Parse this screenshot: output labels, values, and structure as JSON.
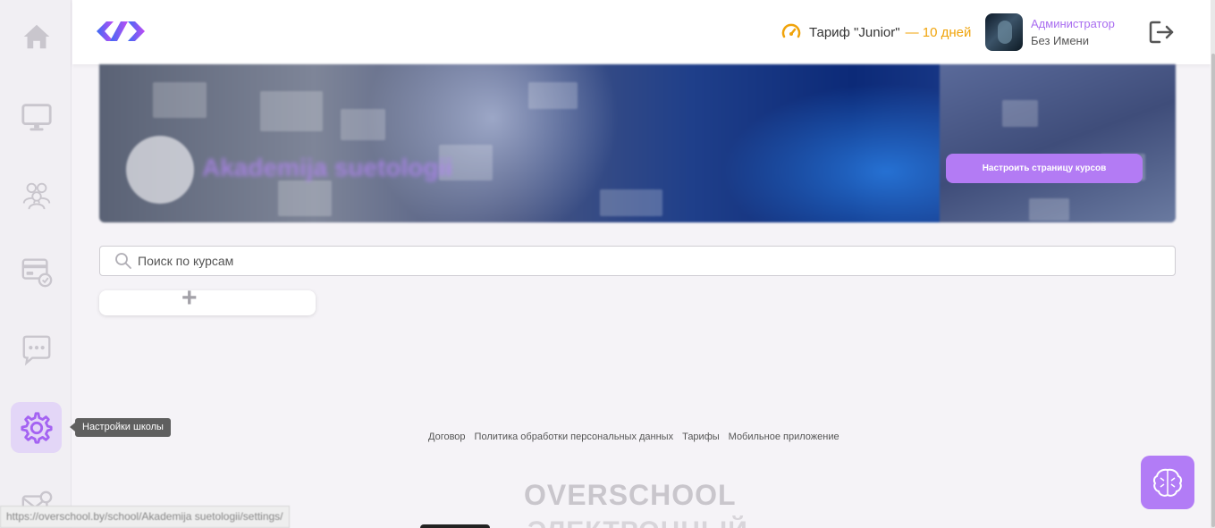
{
  "header": {
    "tariff_label": "Тариф \"Junior\"",
    "tariff_days": "— 10 дней",
    "user_role": "Администратор",
    "user_name": "Без Имени"
  },
  "banner": {
    "school_title": "Akademija suetologii",
    "customize_button": "Настроить страницу курсов"
  },
  "search": {
    "placeholder": "Поиск по курсам"
  },
  "add_card": {
    "label": "+"
  },
  "sidebar": {
    "tooltip": "Настройки школы",
    "items": [
      {
        "icon": "home-icon"
      },
      {
        "icon": "monitor-icon"
      },
      {
        "icon": "users-icon"
      },
      {
        "icon": "payments-icon"
      },
      {
        "icon": "chat-icon"
      },
      {
        "icon": "gear-icon",
        "active": true
      },
      {
        "icon": "mail-icon"
      }
    ]
  },
  "footer": {
    "links": [
      "Договор",
      "Политика обработки персональных данных",
      "Тарифы",
      "Мобильное приложение"
    ],
    "brand": "OVERSCHOOL",
    "brand_secondary": "ЭЛЕКТРОННЫЙ"
  },
  "status_bar": {
    "url": "https://overschool.by/school/Akademija suetologii/settings/"
  },
  "colors": {
    "accent": "#b37bf4",
    "tariff_accent": "#f0a30a",
    "sidebar_icon": "#c9c6cd",
    "active_icon": "#a463f2"
  }
}
